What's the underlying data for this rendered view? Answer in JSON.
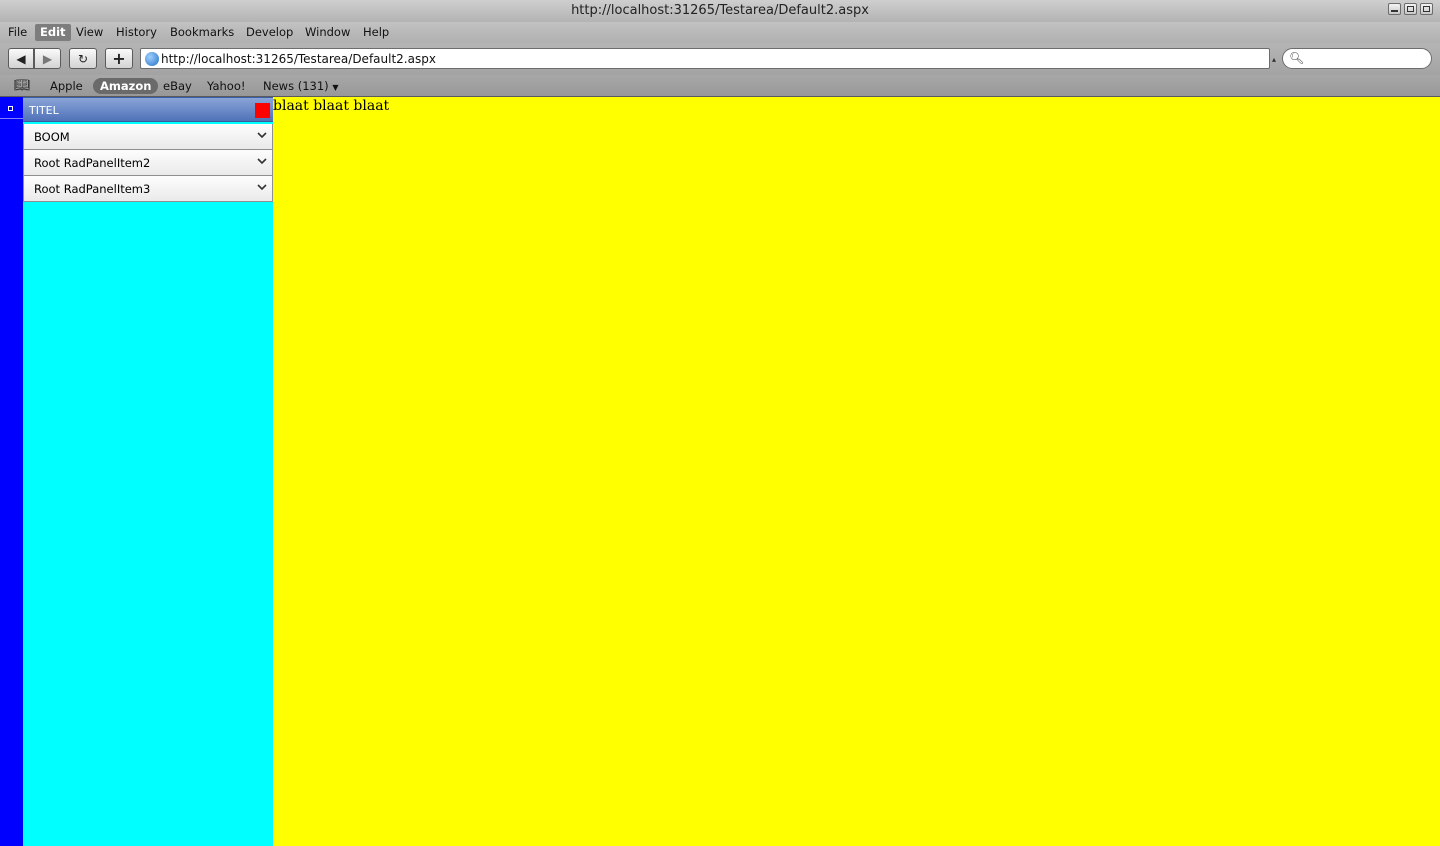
{
  "window": {
    "title": "http://localhost:31265/Testarea/Default2.aspx"
  },
  "menu": {
    "items": [
      "File",
      "Edit",
      "View",
      "History",
      "Bookmarks",
      "Develop",
      "Window",
      "Help"
    ],
    "active": "Edit"
  },
  "toolbar": {
    "address": "http://localhost:31265/Testarea/Default2.aspx",
    "search_placeholder": ""
  },
  "bookmarks": {
    "items": [
      "Apple",
      "Amazon",
      "eBay",
      "Yahoo!",
      "News (131)"
    ],
    "active": "Amazon"
  },
  "panel": {
    "title": "TITEL",
    "items": [
      {
        "label": "BOOM"
      },
      {
        "label": "Root RadPanelItem2"
      },
      {
        "label": "Root RadPanelItem3"
      }
    ]
  },
  "content": {
    "text": "blaat blaat blaat"
  },
  "colors": {
    "left_strip": "#0000ff",
    "side_pane": "#00ffff",
    "content_bg": "#ffff00",
    "close_button": "#ff0000"
  }
}
